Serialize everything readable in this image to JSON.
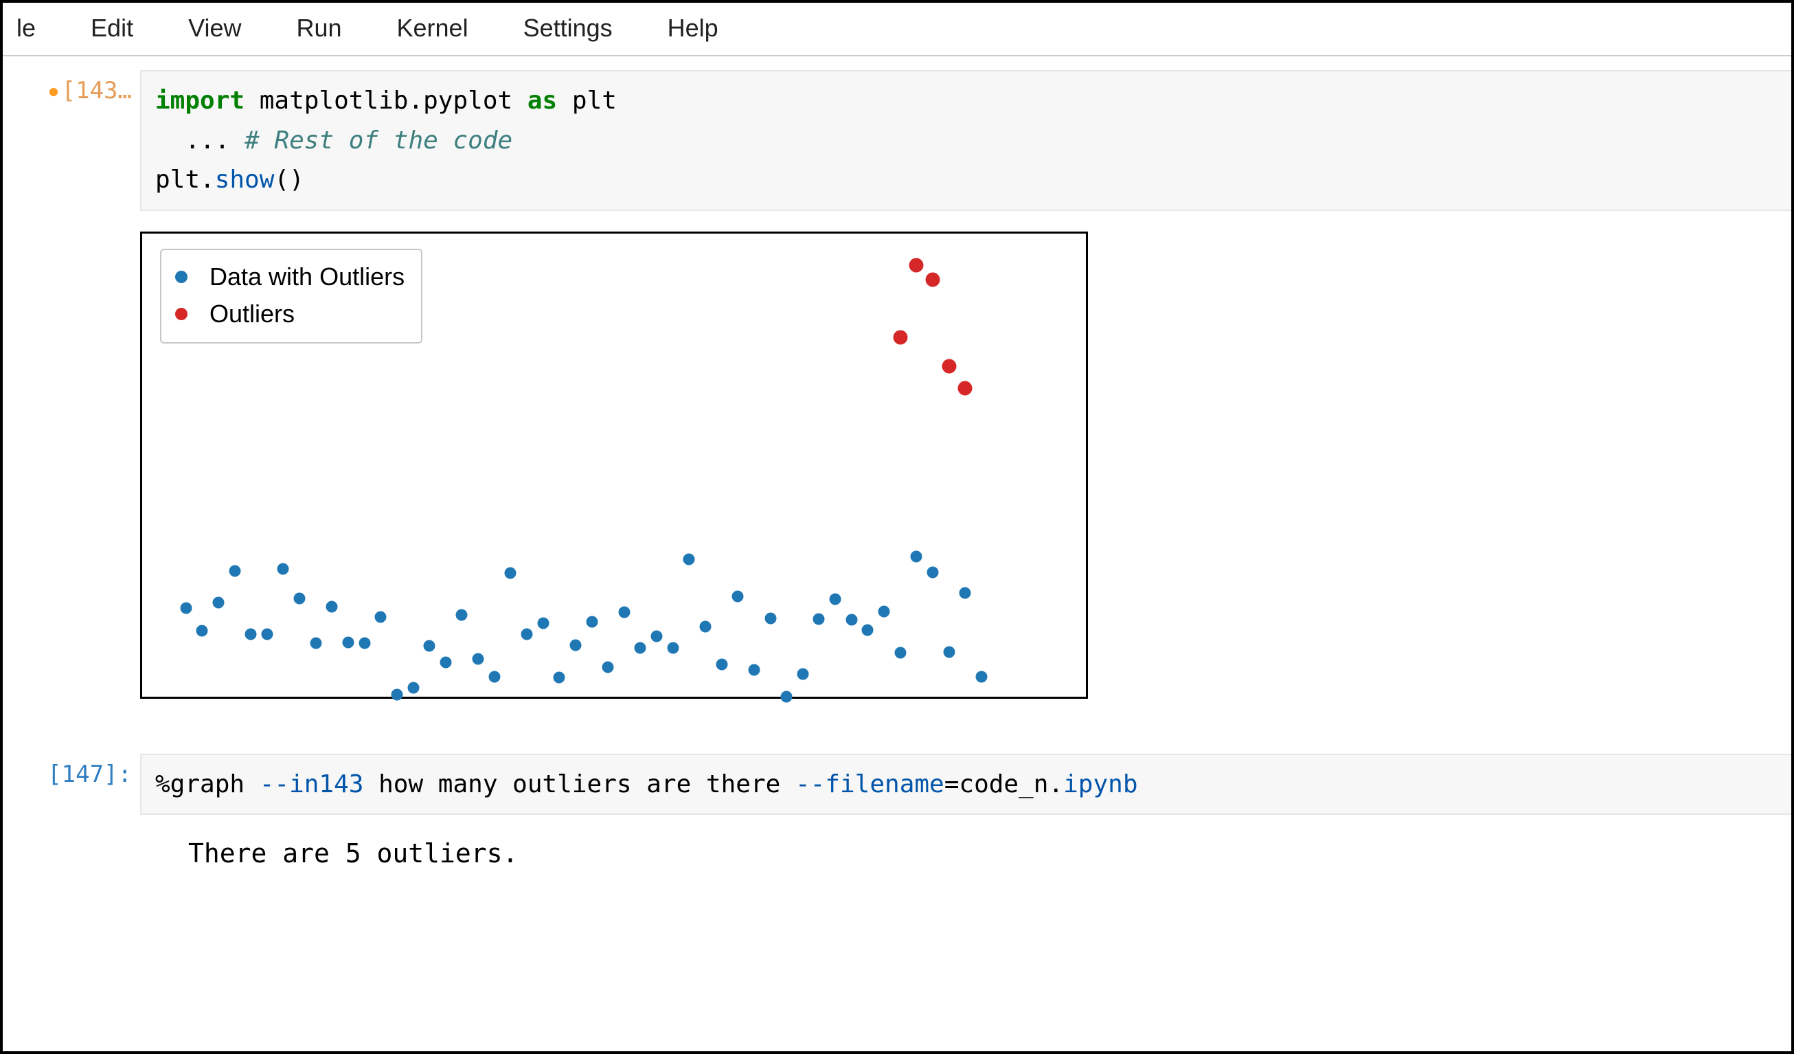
{
  "menu": {
    "items": [
      "le",
      "Edit",
      "View",
      "Run",
      "Kernel",
      "Settings",
      "Help"
    ]
  },
  "cells": [
    {
      "prompt": "[143…",
      "unsaved": true,
      "code": {
        "line1_kw1": "import",
        "line1_mid": " matplotlib.pyplot ",
        "line1_kw2": "as",
        "line1_end": " plt",
        "line2_pre": "  ... ",
        "line2_comment": "# Rest of the code",
        "line3_a": "plt.",
        "line3_b": "show",
        "line3_c": "()"
      }
    },
    {
      "prompt": "[147]:",
      "code": {
        "magic": "%graph ",
        "flag1": "--in143",
        "mid": " how many outliers are there ",
        "flag2": "--filename",
        "eq": "=code_n.",
        "ext": "ipynb"
      },
      "output": "There are 5 outliers."
    }
  ],
  "legend": {
    "items": [
      {
        "label": "Data with Outliers",
        "color": "#1f77b4"
      },
      {
        "label": "Outliers",
        "color": "#d62728"
      }
    ]
  },
  "chart_data": {
    "type": "scatter",
    "title": "",
    "xlabel": "",
    "ylabel": "",
    "xlim": [
      0,
      55
    ],
    "ylim": [
      -1.5,
      10.5
    ],
    "legend_position": "upper left",
    "series": [
      {
        "name": "Data with Outliers",
        "color": "#1f77b4",
        "x": [
          1,
          2,
          3,
          4,
          5,
          6,
          7,
          8,
          9,
          10,
          11,
          12,
          13,
          14,
          15,
          16,
          17,
          18,
          19,
          20,
          21,
          22,
          23,
          24,
          25,
          26,
          27,
          28,
          29,
          30,
          31,
          32,
          33,
          34,
          35,
          36,
          37,
          38,
          39,
          40,
          41,
          42,
          43,
          44,
          45,
          46,
          47,
          48,
          49,
          50
        ],
        "y": [
          0.5,
          -0.14,
          0.65,
          1.52,
          -0.23,
          -0.23,
          1.58,
          0.77,
          -0.47,
          0.54,
          -0.46,
          -0.47,
          0.24,
          -1.91,
          -1.72,
          -0.56,
          -1.01,
          0.31,
          -0.91,
          -1.41,
          1.47,
          -0.23,
          0.07,
          -1.42,
          -0.54,
          0.11,
          -1.15,
          0.38,
          -0.6,
          -0.29,
          -0.6,
          1.85,
          -0.01,
          -1.06,
          0.82,
          -1.22,
          0.21,
          -1.96,
          -1.33,
          0.2,
          0.74,
          0.17,
          -0.12,
          0.41,
          -0.75,
          1.92,
          1.48,
          -0.72,
          0.92,
          -1.4
        ]
      },
      {
        "name": "Outliers",
        "color": "#d62728",
        "x": [
          45,
          46,
          47,
          48,
          49
        ],
        "y": [
          8.0,
          10.0,
          9.6,
          7.2,
          6.6
        ]
      }
    ]
  }
}
